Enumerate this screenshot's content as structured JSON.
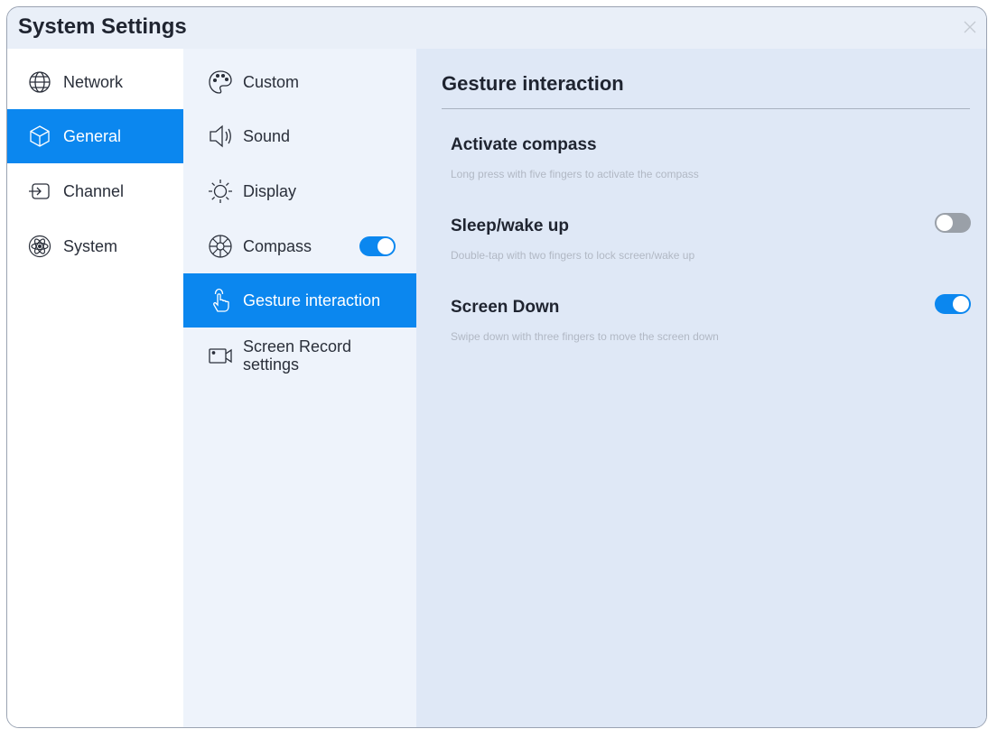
{
  "window": {
    "title": "System Settings"
  },
  "nav": {
    "items": [
      {
        "label": "Network",
        "icon": "globe-icon"
      },
      {
        "label": "General",
        "icon": "cube-icon",
        "active": true
      },
      {
        "label": "Channel",
        "icon": "input-icon"
      },
      {
        "label": "System",
        "icon": "atom-icon"
      }
    ]
  },
  "sub": {
    "items": [
      {
        "label": "Custom",
        "icon": "palette-icon"
      },
      {
        "label": "Sound",
        "icon": "speaker-icon"
      },
      {
        "label": "Display",
        "icon": "sun-icon"
      },
      {
        "label": "Compass",
        "icon": "compass-icon",
        "toggle": true
      },
      {
        "label": "Gesture interaction",
        "icon": "hand-pointer-icon",
        "active": true
      },
      {
        "label_line1": "Screen Record",
        "label_line2": "settings",
        "icon": "camera-icon"
      }
    ]
  },
  "panel": {
    "title": "Gesture interaction",
    "settings": [
      {
        "title": "Activate compass",
        "desc": "Long press with five fingers to activate the compass"
      },
      {
        "title": "Sleep/wake up",
        "desc": "Double-tap with two fingers to lock screen/wake up",
        "toggle": false
      },
      {
        "title": "Screen Down",
        "desc": "Swipe down with three fingers to move the screen down",
        "toggle": true
      }
    ]
  },
  "colors": {
    "accent": "#0b87ef",
    "toggle_off": "#9aa0a8"
  }
}
